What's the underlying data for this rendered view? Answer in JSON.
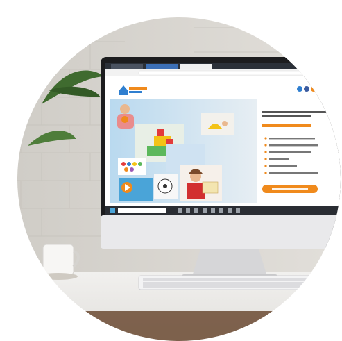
{
  "scene": {
    "description_tag": "photo",
    "colors": {
      "wall": "#d9d6d0",
      "brick_line": "#c7c3bc",
      "desk": "#ecebe8",
      "monitor_frame": "#1c1c1e",
      "monitor_chin": "#e9e9eb",
      "stand": "#d8d8da",
      "site_bg": "#ffffff",
      "accent_orange": "#f08a1c",
      "accent_blue": "#2f7fd0",
      "taskbar": "#2a2d33",
      "browser_bar": "#2b3038",
      "plant": "#3f6b2f"
    },
    "icons": [
      "plant-leaf-icon",
      "cup-icon",
      "keyboard-icon",
      "play-icon",
      "logo-house-icon"
    ]
  },
  "site": {
    "hero_cta_color": "#f08a1c",
    "social_colors": [
      "#2f7fd0",
      "#3a5ba0",
      "#f08a1c",
      "#4cb3e6",
      "#cc3333",
      "#5577cc"
    ]
  }
}
